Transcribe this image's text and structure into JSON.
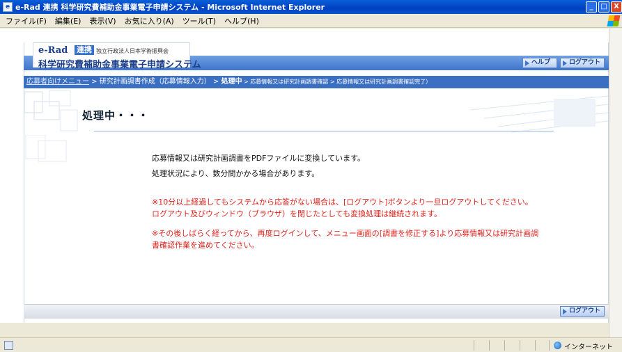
{
  "window": {
    "title": "e-Rad 連携 科学研究費補助金事業電子申請システム - Microsoft Internet Explorer",
    "icon_glyph": "e"
  },
  "menu": [
    "ファイル(F)",
    "編集(E)",
    "表示(V)",
    "お気に入り(A)",
    "ツール(T)",
    "ヘルプ(H)"
  ],
  "header": {
    "logo_erad": "e-Rad",
    "logo_renkei": "連携",
    "logo_org": "独立行政法人日本学術振興会",
    "logo_system": "科学研究費補助金事業電子申請システム",
    "help_label": "ヘルプ",
    "logout_label": "ログアウト"
  },
  "breadcrumb": {
    "link": "応募者向けメニュー",
    "sep": " > ",
    "step1": "研究計画調書作成（応募情報入力）",
    "current": "処理中",
    "step3": "応募情報又は研究計画調書確認",
    "step4": "応募情報又は研究計画調書確認完了）"
  },
  "page": {
    "title": "処理中・・・",
    "message1": "応募情報又は研究計画調書をPDFファイルに変換しています。",
    "message2": "処理状況により、数分間かかる場合があります。",
    "warning1_line1": "※10分以上経過してもシステムから応答がない場合は、[ログアウト]ボタンより一旦ログアウトしてください。",
    "warning1_line2": "ログアウト及びウィンドウ（ブラウザ）を閉じたとしても変換処理は継続されます。",
    "warning2_line1": "※その後しばらく経ってから、再度ログインして、メニュー画面の[調書を修正する]より応募情報又は研究計画調",
    "warning2_line2": "書確認作業を進めてください。",
    "logout_bottom_label": "ログアウト"
  },
  "status": {
    "zone": "インターネット"
  },
  "colors": {
    "accent": "#3b6fc2",
    "warning": "#e0211b"
  }
}
